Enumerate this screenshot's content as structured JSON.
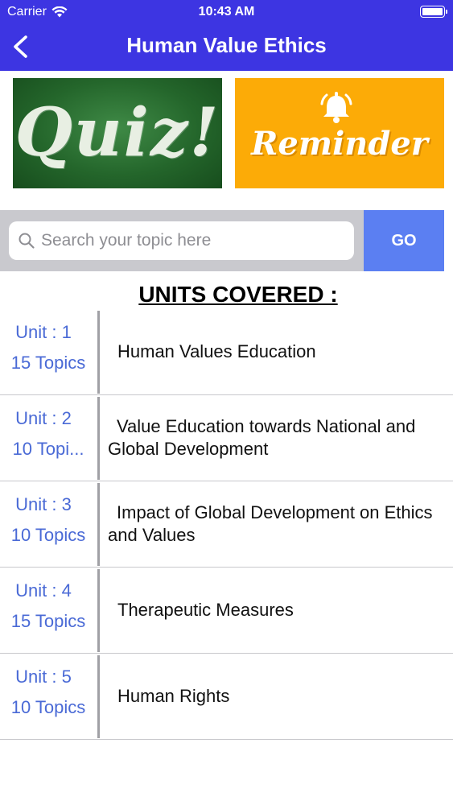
{
  "status_bar": {
    "carrier": "Carrier",
    "time": "10:43 AM"
  },
  "nav": {
    "title": "Human Value Ethics"
  },
  "banners": {
    "quiz": "Quiz!",
    "reminder": "Reminder"
  },
  "search": {
    "placeholder": "Search your topic here",
    "value": "",
    "go_label": "GO"
  },
  "units_heading": "UNITS COVERED :",
  "units": [
    {
      "unit": "Unit : 1",
      "topics": "15 Topics",
      "title": "Human Values Education"
    },
    {
      "unit": "Unit : 2",
      "topics": "10 Topi...",
      "title": "Value Education towards National and Global Development"
    },
    {
      "unit": "Unit : 3",
      "topics": "10 Topics",
      "title": "Impact of Global Development on Ethics and Values"
    },
    {
      "unit": "Unit : 4",
      "topics": "15 Topics",
      "title": "Therapeutic Measures"
    },
    {
      "unit": "Unit : 5",
      "topics": "10 Topics",
      "title": "Human Rights"
    }
  ],
  "colors": {
    "header": "#3d35e2",
    "go_button": "#5b7ff2",
    "link_text": "#4a6ad6",
    "reminder_bg": "#fcab07",
    "quiz_bg": "#24662b"
  },
  "icons": {
    "back": "chevron-left-icon",
    "search": "magnifier-icon",
    "bell": "bell-icon",
    "wifi": "wifi-icon",
    "battery": "battery-icon"
  }
}
